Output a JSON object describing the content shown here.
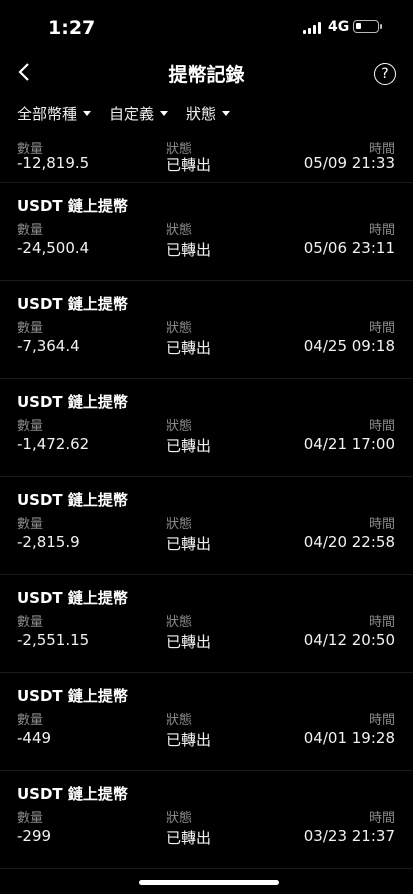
{
  "status": {
    "time": "1:27",
    "network": "4G"
  },
  "nav": {
    "title": "提幣記錄",
    "help": "?"
  },
  "filters": [
    {
      "label": "全部幣種"
    },
    {
      "label": "自定義"
    },
    {
      "label": "狀態"
    }
  ],
  "columns": {
    "amount": "數量",
    "status": "狀態",
    "time": "時間"
  },
  "records": [
    {
      "title": "",
      "amount": "-12,819.5",
      "status": "已轉出",
      "time": "05/09 21:33"
    },
    {
      "title": "USDT 鏈上提幣",
      "amount": "-24,500.4",
      "status": "已轉出",
      "time": "05/06 23:11"
    },
    {
      "title": "USDT 鏈上提幣",
      "amount": "-7,364.4",
      "status": "已轉出",
      "time": "04/25 09:18"
    },
    {
      "title": "USDT 鏈上提幣",
      "amount": "-1,472.62",
      "status": "已轉出",
      "time": "04/21 17:00"
    },
    {
      "title": "USDT 鏈上提幣",
      "amount": "-2,815.9",
      "status": "已轉出",
      "time": "04/20 22:58"
    },
    {
      "title": "USDT 鏈上提幣",
      "amount": "-2,551.15",
      "status": "已轉出",
      "time": "04/12 20:50"
    },
    {
      "title": "USDT 鏈上提幣",
      "amount": "-449",
      "status": "已轉出",
      "time": "04/01 19:28"
    },
    {
      "title": "USDT 鏈上提幣",
      "amount": "-299",
      "status": "已轉出",
      "time": "03/23 21:37"
    }
  ]
}
